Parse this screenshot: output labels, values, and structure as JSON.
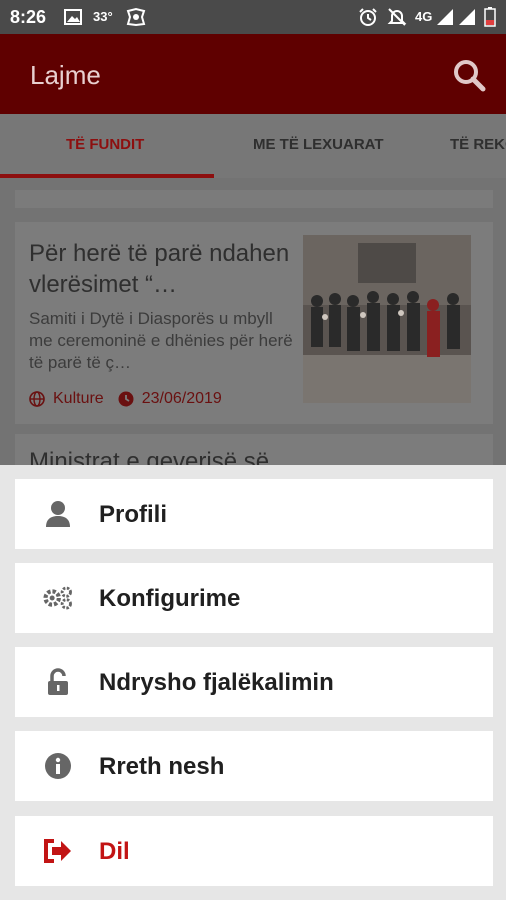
{
  "status_bar": {
    "time": "8:26",
    "temperature": "33°",
    "network": "4G"
  },
  "app_bar": {
    "title": "Lajme"
  },
  "tabs": [
    {
      "label": "TË FUNDIT",
      "active": true
    },
    {
      "label": "ME TË LEXUARAT",
      "active": false
    },
    {
      "label": "TË REKOMANDUARA",
      "active": false
    }
  ],
  "articles": [
    {
      "headline": "Për herë të parë ndahen vlerësimet “…",
      "summary": "Samiti i Dytë i Diasporës u mbyll me ceremoninë e dhënies për herë të parë të ç…",
      "category": "Kulture",
      "date": "23/06/2019"
    },
    {
      "headline": "Ministrat e qeverisë së…"
    }
  ],
  "menu": {
    "items": [
      {
        "label": "Profili",
        "icon": "user-icon"
      },
      {
        "label": "Konfigurime",
        "icon": "gears-icon"
      },
      {
        "label": "Ndrysho fjalëkalimin",
        "icon": "unlock-icon"
      },
      {
        "label": "Rreth nesh",
        "icon": "info-icon"
      },
      {
        "label": "Dil",
        "icon": "sign-out-icon"
      }
    ]
  },
  "colors": {
    "brand_red": "#8d0f0f",
    "danger": "#c21414"
  }
}
